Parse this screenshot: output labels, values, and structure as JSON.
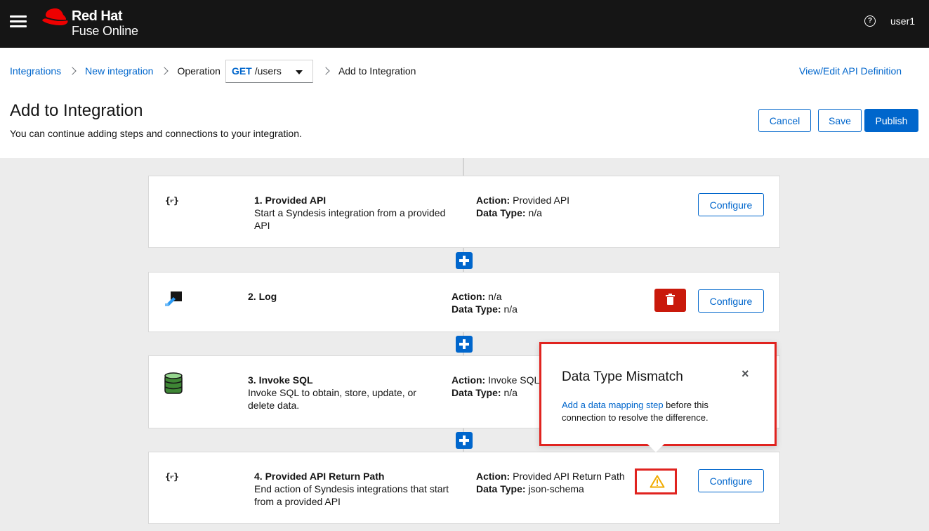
{
  "masthead": {
    "brand_line1": "Red Hat",
    "brand_line2": "Fuse Online",
    "help_glyph": "?",
    "user": "user1"
  },
  "breadcrumb": {
    "items": [
      "Integrations",
      "New integration",
      "Operation",
      "Add to Integration"
    ],
    "operation": {
      "method": "GET",
      "path": "/users"
    },
    "view_edit_link": "View/Edit API Definition"
  },
  "page": {
    "title": "Add to Integration",
    "description": "You can continue adding steps and connections to your integration.",
    "buttons": {
      "cancel": "Cancel",
      "save": "Save",
      "publish": "Publish"
    }
  },
  "steps": [
    {
      "title": "1. Provided API",
      "description": "Start a Syndesis integration from a provided API",
      "action_label": "Action:",
      "action": "Provided API",
      "datatype_label": "Data Type:",
      "datatype": "n/a",
      "icon": "api-icon",
      "configure": "Configure"
    },
    {
      "title": "2. Log",
      "description": "",
      "action_label": "Action:",
      "action": "n/a",
      "datatype_label": "Data Type:",
      "datatype": "n/a",
      "icon": "log-icon",
      "configure": "Configure"
    },
    {
      "title": "3. Invoke SQL",
      "description": "Invoke SQL to obtain, store, update, or delete data.",
      "action_label": "Action:",
      "action": "Invoke SQL",
      "datatype_label": "Data Type:",
      "datatype": "n/a",
      "icon": "database-icon",
      "configure": "Configure"
    },
    {
      "title": "4. Provided API Return Path",
      "description": "End action of Syndesis integrations that start from a provided API",
      "action_label": "Action:",
      "action": "Provided API Return Path",
      "datatype_label": "Data Type:",
      "datatype": "json-schema",
      "icon": "api-icon",
      "configure": "Configure"
    }
  ],
  "popover": {
    "title": "Data Type Mismatch",
    "close": "×",
    "link_text": "Add a data mapping step",
    "body_text": " before this connection to resolve the difference."
  },
  "colors": {
    "masthead": "#151515",
    "brand_red": "#ee0000",
    "link": "#0066cc",
    "danger": "#c9190b",
    "highlight": "#e0231f",
    "warning": "#f0ab00",
    "canvas": "#ececec"
  }
}
